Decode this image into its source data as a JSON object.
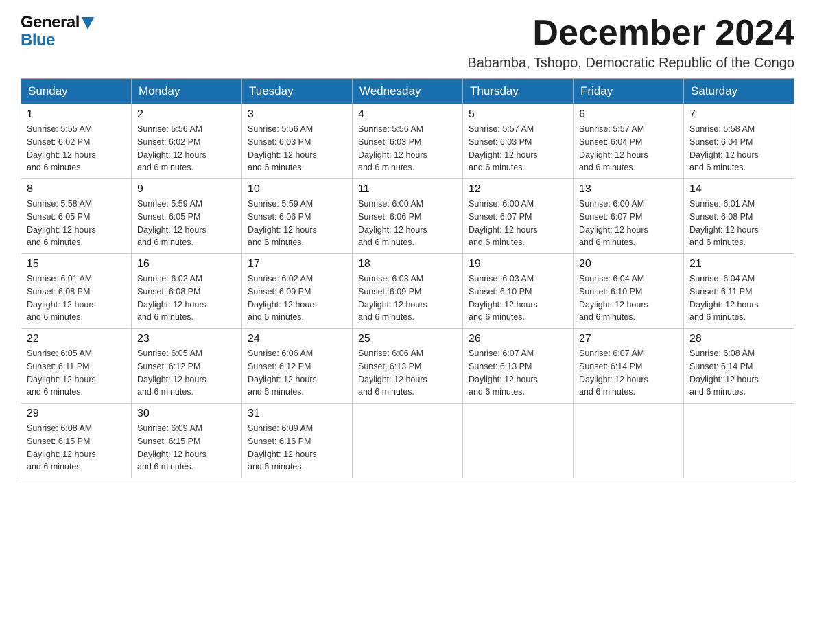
{
  "logo": {
    "general": "General",
    "blue": "Blue"
  },
  "header": {
    "month_title": "December 2024",
    "subtitle": "Babamba, Tshopo, Democratic Republic of the Congo"
  },
  "days_of_week": [
    "Sunday",
    "Monday",
    "Tuesday",
    "Wednesday",
    "Thursday",
    "Friday",
    "Saturday"
  ],
  "weeks": [
    [
      {
        "day": "1",
        "sunrise": "5:55 AM",
        "sunset": "6:02 PM",
        "daylight": "12 hours and 6 minutes."
      },
      {
        "day": "2",
        "sunrise": "5:56 AM",
        "sunset": "6:02 PM",
        "daylight": "12 hours and 6 minutes."
      },
      {
        "day": "3",
        "sunrise": "5:56 AM",
        "sunset": "6:03 PM",
        "daylight": "12 hours and 6 minutes."
      },
      {
        "day": "4",
        "sunrise": "5:56 AM",
        "sunset": "6:03 PM",
        "daylight": "12 hours and 6 minutes."
      },
      {
        "day": "5",
        "sunrise": "5:57 AM",
        "sunset": "6:03 PM",
        "daylight": "12 hours and 6 minutes."
      },
      {
        "day": "6",
        "sunrise": "5:57 AM",
        "sunset": "6:04 PM",
        "daylight": "12 hours and 6 minutes."
      },
      {
        "day": "7",
        "sunrise": "5:58 AM",
        "sunset": "6:04 PM",
        "daylight": "12 hours and 6 minutes."
      }
    ],
    [
      {
        "day": "8",
        "sunrise": "5:58 AM",
        "sunset": "6:05 PM",
        "daylight": "12 hours and 6 minutes."
      },
      {
        "day": "9",
        "sunrise": "5:59 AM",
        "sunset": "6:05 PM",
        "daylight": "12 hours and 6 minutes."
      },
      {
        "day": "10",
        "sunrise": "5:59 AM",
        "sunset": "6:06 PM",
        "daylight": "12 hours and 6 minutes."
      },
      {
        "day": "11",
        "sunrise": "6:00 AM",
        "sunset": "6:06 PM",
        "daylight": "12 hours and 6 minutes."
      },
      {
        "day": "12",
        "sunrise": "6:00 AM",
        "sunset": "6:07 PM",
        "daylight": "12 hours and 6 minutes."
      },
      {
        "day": "13",
        "sunrise": "6:00 AM",
        "sunset": "6:07 PM",
        "daylight": "12 hours and 6 minutes."
      },
      {
        "day": "14",
        "sunrise": "6:01 AM",
        "sunset": "6:08 PM",
        "daylight": "12 hours and 6 minutes."
      }
    ],
    [
      {
        "day": "15",
        "sunrise": "6:01 AM",
        "sunset": "6:08 PM",
        "daylight": "12 hours and 6 minutes."
      },
      {
        "day": "16",
        "sunrise": "6:02 AM",
        "sunset": "6:08 PM",
        "daylight": "12 hours and 6 minutes."
      },
      {
        "day": "17",
        "sunrise": "6:02 AM",
        "sunset": "6:09 PM",
        "daylight": "12 hours and 6 minutes."
      },
      {
        "day": "18",
        "sunrise": "6:03 AM",
        "sunset": "6:09 PM",
        "daylight": "12 hours and 6 minutes."
      },
      {
        "day": "19",
        "sunrise": "6:03 AM",
        "sunset": "6:10 PM",
        "daylight": "12 hours and 6 minutes."
      },
      {
        "day": "20",
        "sunrise": "6:04 AM",
        "sunset": "6:10 PM",
        "daylight": "12 hours and 6 minutes."
      },
      {
        "day": "21",
        "sunrise": "6:04 AM",
        "sunset": "6:11 PM",
        "daylight": "12 hours and 6 minutes."
      }
    ],
    [
      {
        "day": "22",
        "sunrise": "6:05 AM",
        "sunset": "6:11 PM",
        "daylight": "12 hours and 6 minutes."
      },
      {
        "day": "23",
        "sunrise": "6:05 AM",
        "sunset": "6:12 PM",
        "daylight": "12 hours and 6 minutes."
      },
      {
        "day": "24",
        "sunrise": "6:06 AM",
        "sunset": "6:12 PM",
        "daylight": "12 hours and 6 minutes."
      },
      {
        "day": "25",
        "sunrise": "6:06 AM",
        "sunset": "6:13 PM",
        "daylight": "12 hours and 6 minutes."
      },
      {
        "day": "26",
        "sunrise": "6:07 AM",
        "sunset": "6:13 PM",
        "daylight": "12 hours and 6 minutes."
      },
      {
        "day": "27",
        "sunrise": "6:07 AM",
        "sunset": "6:14 PM",
        "daylight": "12 hours and 6 minutes."
      },
      {
        "day": "28",
        "sunrise": "6:08 AM",
        "sunset": "6:14 PM",
        "daylight": "12 hours and 6 minutes."
      }
    ],
    [
      {
        "day": "29",
        "sunrise": "6:08 AM",
        "sunset": "6:15 PM",
        "daylight": "12 hours and 6 minutes."
      },
      {
        "day": "30",
        "sunrise": "6:09 AM",
        "sunset": "6:15 PM",
        "daylight": "12 hours and 6 minutes."
      },
      {
        "day": "31",
        "sunrise": "6:09 AM",
        "sunset": "6:16 PM",
        "daylight": "12 hours and 6 minutes."
      },
      null,
      null,
      null,
      null
    ]
  ],
  "labels": {
    "sunrise": "Sunrise:",
    "sunset": "Sunset:",
    "daylight": "Daylight:"
  }
}
